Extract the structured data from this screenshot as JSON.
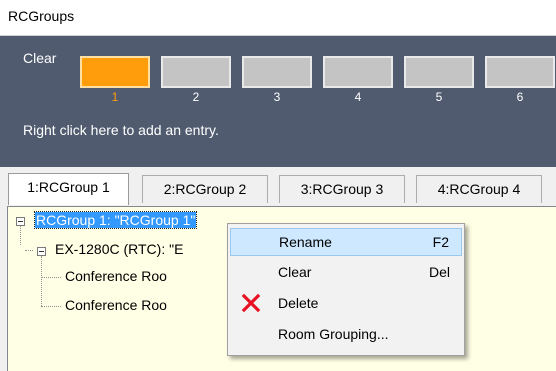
{
  "window": {
    "title": "RCGroups"
  },
  "panel": {
    "clear_label": "Clear",
    "slots": [
      {
        "number": "1",
        "active": true
      },
      {
        "number": "2",
        "active": false
      },
      {
        "number": "3",
        "active": false
      },
      {
        "number": "4",
        "active": false
      },
      {
        "number": "5",
        "active": false
      },
      {
        "number": "6",
        "active": false
      }
    ],
    "hint": "Right click here to add an entry.",
    "colors": {
      "background": "#505b6f",
      "active_slot": "#ff9d0d",
      "inactive_slot": "#c4c4c4"
    }
  },
  "tabs": [
    {
      "label": "1:RCGroup 1",
      "active": true
    },
    {
      "label": "2:RCGroup 2",
      "active": false
    },
    {
      "label": "3:RCGroup 3",
      "active": false
    },
    {
      "label": "4:RCGroup 4",
      "active": false
    }
  ],
  "tree": {
    "root": "RCGroup 1: \"RCGroup 1\"",
    "child": "EX-1280C (RTC): \"E",
    "leaves": [
      "Conference Roo",
      "Conference Roo"
    ],
    "background": "#ffffe6"
  },
  "context_menu": {
    "items": [
      {
        "label": "Rename",
        "shortcut": "F2",
        "icon": "",
        "highlighted": true
      },
      {
        "label": "Clear",
        "shortcut": "Del",
        "icon": "",
        "highlighted": false
      },
      {
        "label": "Delete",
        "shortcut": "",
        "icon": "red-x-icon",
        "highlighted": false
      },
      {
        "label": "Room Grouping...",
        "shortcut": "",
        "icon": "",
        "highlighted": false
      }
    ]
  }
}
